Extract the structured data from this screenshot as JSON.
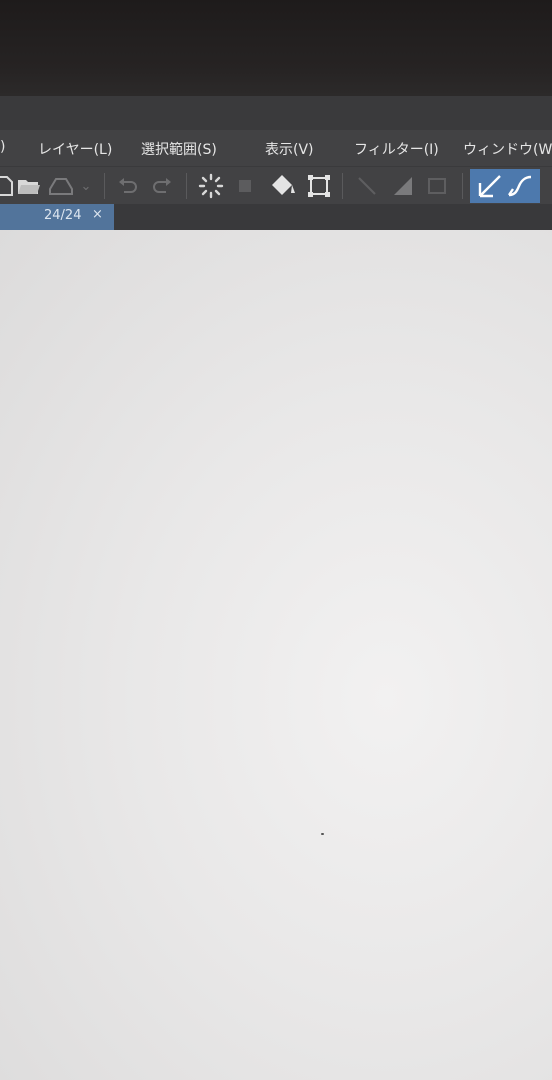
{
  "menu": {
    "items": [
      {
        "name": "menu-edit-partial",
        "label": ")"
      },
      {
        "name": "menu-layer",
        "label": "レイヤー(L)"
      },
      {
        "name": "menu-selection",
        "label": "選択範囲(S)"
      },
      {
        "name": "menu-view",
        "label": "表示(V)"
      },
      {
        "name": "menu-filter",
        "label": "フィルター(I)"
      },
      {
        "name": "menu-window",
        "label": "ウィンドウ(W"
      }
    ]
  },
  "toolbar": {
    "icons": [
      "new-file-icon",
      "open-folder-icon",
      "save-icon",
      "undo-icon",
      "redo-icon",
      "loading-spinner-icon",
      "fill-bucket-icon",
      "transform-icon",
      "line-tool-icon",
      "gradient-icon",
      "rectangle-icon",
      "pen-tool-icon",
      "curve-tool-icon"
    ]
  },
  "tab": {
    "label": "24/24",
    "close": "×"
  },
  "colors": {
    "menubar": "#424244",
    "tab_active": "#52749b",
    "tool_active": "#4d79ad",
    "canvas": "#ecebeb"
  }
}
